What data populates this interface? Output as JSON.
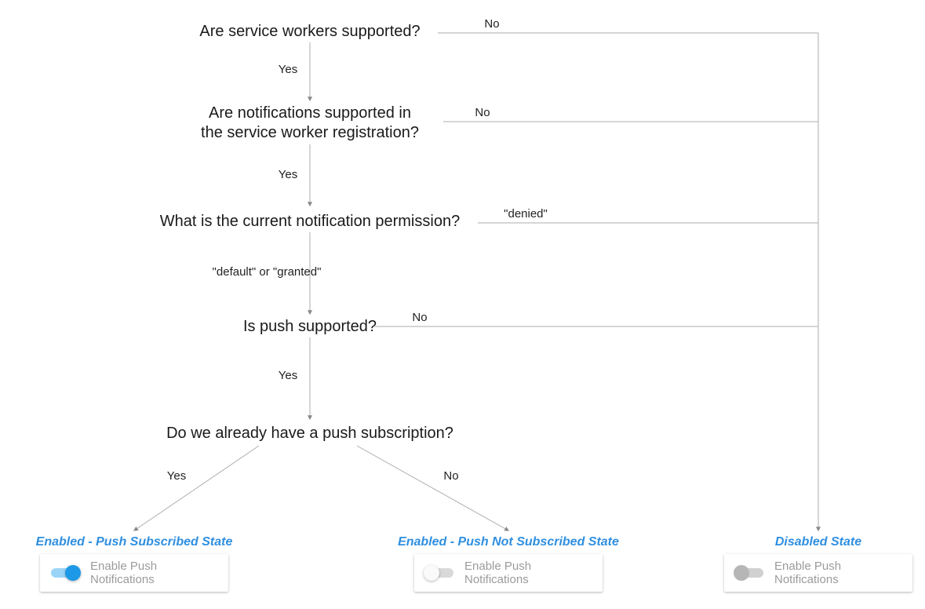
{
  "nodes": {
    "q1": "Are service workers supported?",
    "q2": "Are notifications supported in\nthe service worker registration?",
    "q3": "What is the current notification permission?",
    "q4": "Is push supported?",
    "q5": "Do we already have a push subscription?"
  },
  "edges": {
    "q1_yes": "Yes",
    "q1_no": "No",
    "q2_yes": "Yes",
    "q2_no": "No",
    "q3_default": "\"default\" or \"granted\"",
    "q3_denied": "\"denied\"",
    "q4_yes": "Yes",
    "q4_no": "No",
    "q5_yes": "Yes",
    "q5_no": "No"
  },
  "states": {
    "subscribed": {
      "title": "Enabled - Push Subscribed State",
      "card_label": "Enable Push Notifications",
      "toggle": "on"
    },
    "not_subscribed": {
      "title": "Enabled - Push Not Subscribed State",
      "card_label": "Enable Push Notifications",
      "toggle": "off"
    },
    "disabled": {
      "title": "Disabled State",
      "card_label": "Enable Push Notifications",
      "toggle": "disabled"
    }
  },
  "chart_data": {
    "type": "flowchart",
    "nodes": [
      {
        "id": "q1",
        "text": "Are service workers supported?"
      },
      {
        "id": "q2",
        "text": "Are notifications supported in the service worker registration?"
      },
      {
        "id": "q3",
        "text": "What is the current notification permission?"
      },
      {
        "id": "q4",
        "text": "Is push supported?"
      },
      {
        "id": "q5",
        "text": "Do we already have a push subscription?"
      },
      {
        "id": "state_subscribed",
        "text": "Enabled - Push Subscribed State"
      },
      {
        "id": "state_not_subscribed",
        "text": "Enabled - Push Not Subscribed State"
      },
      {
        "id": "state_disabled",
        "text": "Disabled State"
      }
    ],
    "edges": [
      {
        "from": "q1",
        "to": "q2",
        "label": "Yes"
      },
      {
        "from": "q1",
        "to": "state_disabled",
        "label": "No"
      },
      {
        "from": "q2",
        "to": "q3",
        "label": "Yes"
      },
      {
        "from": "q2",
        "to": "state_disabled",
        "label": "No"
      },
      {
        "from": "q3",
        "to": "q4",
        "label": "\"default\" or \"granted\""
      },
      {
        "from": "q3",
        "to": "state_disabled",
        "label": "\"denied\""
      },
      {
        "from": "q4",
        "to": "q5",
        "label": "Yes"
      },
      {
        "from": "q4",
        "to": "state_disabled",
        "label": "No"
      },
      {
        "from": "q5",
        "to": "state_subscribed",
        "label": "Yes"
      },
      {
        "from": "q5",
        "to": "state_not_subscribed",
        "label": "No"
      }
    ]
  }
}
